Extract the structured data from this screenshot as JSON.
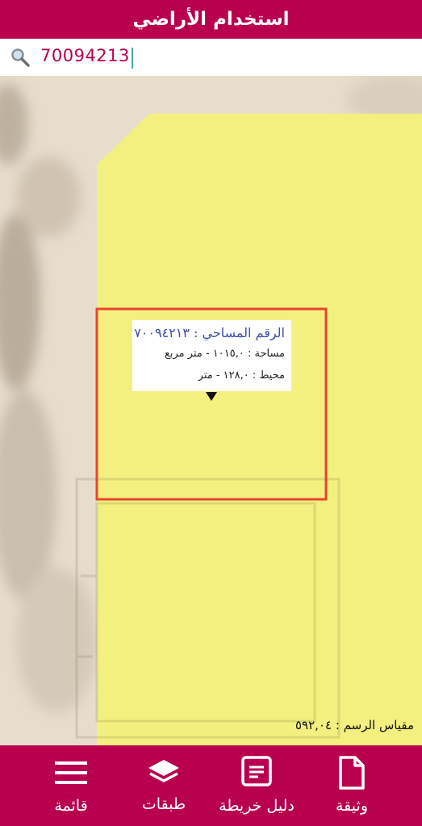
{
  "header": {
    "title": "استخدام الأراضي"
  },
  "search": {
    "icon": "search-icon",
    "value": "70094213"
  },
  "popup": {
    "parcel_line": "الرقم المساحي : ٧٠٠٩٤٢١٣",
    "area_line": "مساحة : ١٠١٥,٠ - متر مربع",
    "perimeter_line": "محيط : ١٢٨,٠ - متر"
  },
  "map": {
    "scale_text": "مقياس الرسم : ٥٩٢,٠٤",
    "parcel_fill": "#f4f07a",
    "highlight_color": "#e8452f"
  },
  "bottom_nav": {
    "items": [
      {
        "label": "قائمة",
        "icon": "menu-icon"
      },
      {
        "label": "طبقات",
        "icon": "layers-icon"
      },
      {
        "label": "دليل خريطة",
        "icon": "map-legend-icon"
      },
      {
        "label": "وثيقة",
        "icon": "document-icon"
      }
    ]
  },
  "colors": {
    "brand": "#b8004f",
    "accent_text": "#3d4fa8"
  }
}
